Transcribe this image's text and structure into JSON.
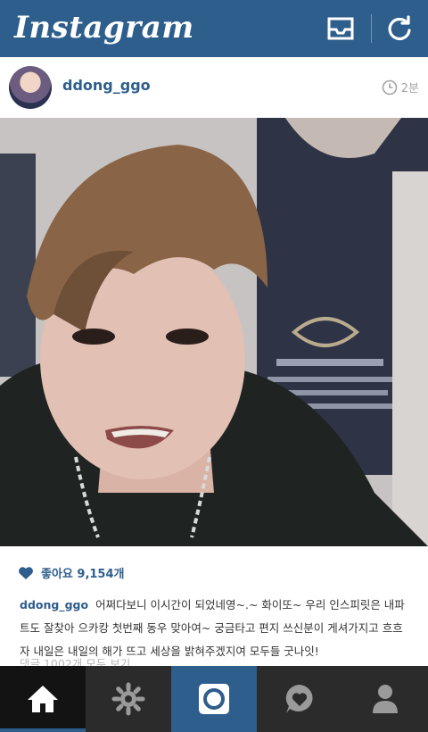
{
  "topbar": {
    "logo_text": "Instagram",
    "icons": [
      "inbox-icon",
      "refresh-icon"
    ]
  },
  "post": {
    "username": "ddong_ggo",
    "timestamp": "2분",
    "likes_text": "좋아요 9,154개",
    "caption_username": "ddong_ggo",
    "caption_text": "어쩌다보니 이시간이 되었네영~.~ 화이또~ 우리 인스피릿은 내파트도 잘찾아 으카캉 첫번째 동우 맞아여~ 궁금타고 편지 쓰신분이 게셔가지고 흐흐 자 내일은 내일의 해가 뜨고 세상을 밝혀주겠지여 모두들 굿나잇!",
    "comments_text": "댓글 1002개 모두 보기"
  },
  "tabbar": {
    "tabs": [
      "home-icon",
      "explore-icon",
      "camera-icon",
      "activity-icon",
      "profile-icon"
    ],
    "active": "home-icon"
  },
  "colors": {
    "brand": "#2e5e8c",
    "tabbar": "#2b2b2b",
    "tabbar_active": "#131313"
  }
}
